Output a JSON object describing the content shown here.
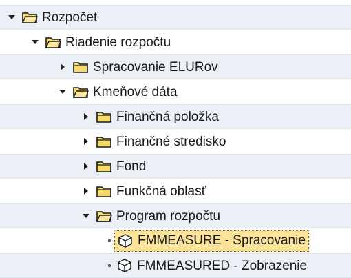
{
  "tree": [
    {
      "label": "Rozpočet",
      "kind": "folder",
      "state": "expanded"
    },
    {
      "label": "Riadenie rozpočtu",
      "kind": "folder",
      "state": "expanded"
    },
    {
      "label": "Spracovanie ELURov",
      "kind": "folder",
      "state": "collapsed"
    },
    {
      "label": "Kmeňové dáta",
      "kind": "folder",
      "state": "expanded"
    },
    {
      "label": "Finančná položka",
      "kind": "folder",
      "state": "collapsed"
    },
    {
      "label": "Finančné stredisko",
      "kind": "folder",
      "state": "collapsed"
    },
    {
      "label": "Fond",
      "kind": "folder",
      "state": "collapsed"
    },
    {
      "label": "Funkčná oblasť",
      "kind": "folder",
      "state": "collapsed"
    },
    {
      "label": "Program rozpočtu",
      "kind": "folder",
      "state": "expanded"
    },
    {
      "label": "FMMEASURE - Spracovanie",
      "kind": "transaction",
      "selected": true
    },
    {
      "label": "FMMEASURED - Zobrazenie",
      "kind": "transaction",
      "selected": false
    }
  ],
  "colors": {
    "row_stripe": "#eaf0f5",
    "selection": "#fbe39a",
    "folder_fill": "#f6d96b",
    "folder_outline": "#1a1a1a"
  },
  "icons": {
    "expanded_toggle": "triangle-down-icon",
    "collapsed_toggle": "triangle-right-icon",
    "folder": "folder-icon",
    "open_folder": "folder-open-icon",
    "transaction": "transaction-cube-icon",
    "leaf_bullet": "bullet-icon"
  }
}
